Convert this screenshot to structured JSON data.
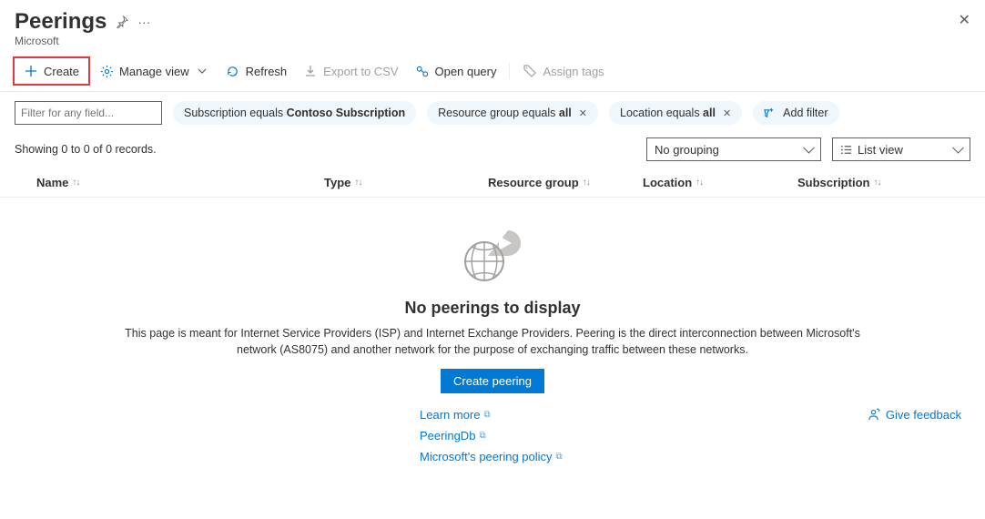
{
  "header": {
    "title": "Peerings",
    "subtitle": "Microsoft"
  },
  "toolbar": {
    "create": "Create",
    "manage_view": "Manage view",
    "refresh": "Refresh",
    "export_csv": "Export to CSV",
    "open_query": "Open query",
    "assign_tags": "Assign tags"
  },
  "filters": {
    "text_placeholder": "Filter for any field...",
    "sub_label": "Subscription equals ",
    "sub_value": "Contoso Subscription",
    "rg_label": "Resource group equals ",
    "rg_value": "all",
    "loc_label": "Location equals ",
    "loc_value": "all",
    "add_filter": "Add filter"
  },
  "summary": {
    "showing": "Showing 0 to 0 of 0 records.",
    "grouping": "No grouping",
    "listview": "List view"
  },
  "columns": {
    "name": "Name",
    "type": "Type",
    "rg": "Resource group",
    "location": "Location",
    "subscription": "Subscription"
  },
  "empty": {
    "title": "No peerings to display",
    "desc": "This page is meant for Internet Service Providers (ISP) and Internet Exchange Providers. Peering is the direct interconnection between Microsoft's network (AS8075) and another network for the purpose of exchanging traffic between these networks.",
    "button": "Create peering",
    "links": {
      "learn": "Learn more",
      "peeringdb": "PeeringDb",
      "policy": "Microsoft's peering policy"
    },
    "feedback": "Give feedback"
  }
}
